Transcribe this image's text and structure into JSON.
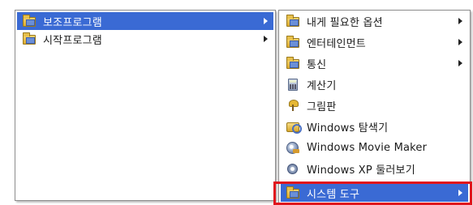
{
  "left_menu": {
    "items": [
      {
        "label": "보조프로그램",
        "icon": "folder-icon",
        "selected": true,
        "has_submenu": true
      },
      {
        "label": "시작프로그램",
        "icon": "folder-icon",
        "selected": false,
        "has_submenu": true
      }
    ]
  },
  "right_menu": {
    "items": [
      {
        "label": "내게 필요한 옵션",
        "icon": "folder-icon",
        "has_submenu": true
      },
      {
        "label": "엔터테인먼트",
        "icon": "folder-icon",
        "has_submenu": true
      },
      {
        "label": "통신",
        "icon": "folder-icon",
        "has_submenu": true
      },
      {
        "label": "계산기",
        "icon": "calculator-icon",
        "has_submenu": false
      },
      {
        "label": "그림판",
        "icon": "paint-icon",
        "has_submenu": false
      },
      {
        "label": "Windows 탐색기",
        "icon": "explorer-icon",
        "has_submenu": false
      },
      {
        "label": "Windows Movie Maker",
        "icon": "movie-maker-icon",
        "has_submenu": false
      },
      {
        "label": "Windows XP 둘러보기",
        "icon": "media-icon",
        "has_submenu": false
      },
      {
        "label": "시스템 도구",
        "icon": "folder-icon",
        "has_submenu": true,
        "selected": true
      }
    ]
  },
  "colors": {
    "selection": "#3a6ad4",
    "highlight_border": "#e0141c"
  }
}
